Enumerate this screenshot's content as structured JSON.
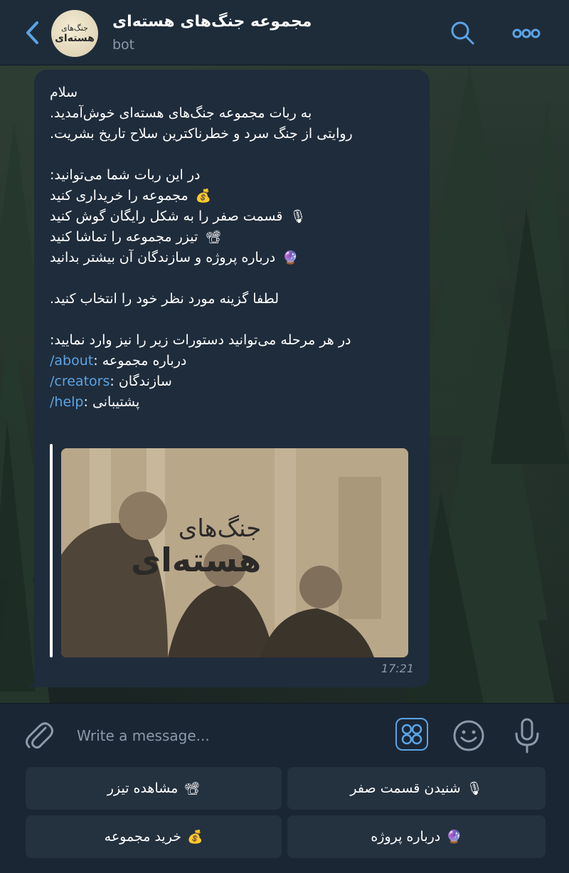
{
  "header": {
    "title": "مجموعه جنگ‌های هسته‌ای",
    "subtitle": "bot",
    "avatar_line1": "جنگ‌های",
    "avatar_line2": "هسته‌ای"
  },
  "message": {
    "lines": [
      "سلام",
      "به ربات مجموعه جنگ‌های هسته‌ای خوش‌آمدید.",
      "روایتی از جنگ سرد و خطرناکترین سلاح تاریخ بشریت.",
      "",
      "در این ربات شما می‌توانید:",
      "مجموعه را خریداری کنید",
      "قسمت صفر را به شکل رایگان گوش کنید",
      "تیزر مجموعه را تماشا کنید",
      "درباره پروژه و سازندگان آن بیشتر بدانید",
      "",
      "لطفا گزینه مورد نظر خود را انتخاب کنید.",
      "",
      "در هر مرحله می‌توانید دستورات زیر را نیز وارد نمایید:"
    ],
    "emojis": {
      "buy": "💰",
      "listen": "🎙",
      "teaser": "📽",
      "about": "🔮"
    },
    "commands": [
      {
        "cmd": "/about",
        "desc": ": درباره مجموعه"
      },
      {
        "cmd": "/creators",
        "desc": ": سازندگان"
      },
      {
        "cmd": "/help",
        "desc": ": پشتیبانی"
      }
    ],
    "media_logo_line1": "جنگ‌های",
    "media_logo_line2": "هسته‌ای",
    "time": "17:21"
  },
  "composer": {
    "placeholder": "Write a message..."
  },
  "reply_keyboard": [
    {
      "label": "شنیدن قسمت صفر",
      "emoji": "🎙"
    },
    {
      "label": "مشاهده تیزر",
      "emoji": "📽"
    },
    {
      "label": "درباره پروژه",
      "emoji": "🔮"
    },
    {
      "label": "خرید مجموعه",
      "emoji": "💰"
    }
  ],
  "colors": {
    "accent": "#5ba4e6",
    "bubble": "#1f2c3b",
    "header": "#1e2c3a",
    "muted": "#8b9aa8"
  }
}
